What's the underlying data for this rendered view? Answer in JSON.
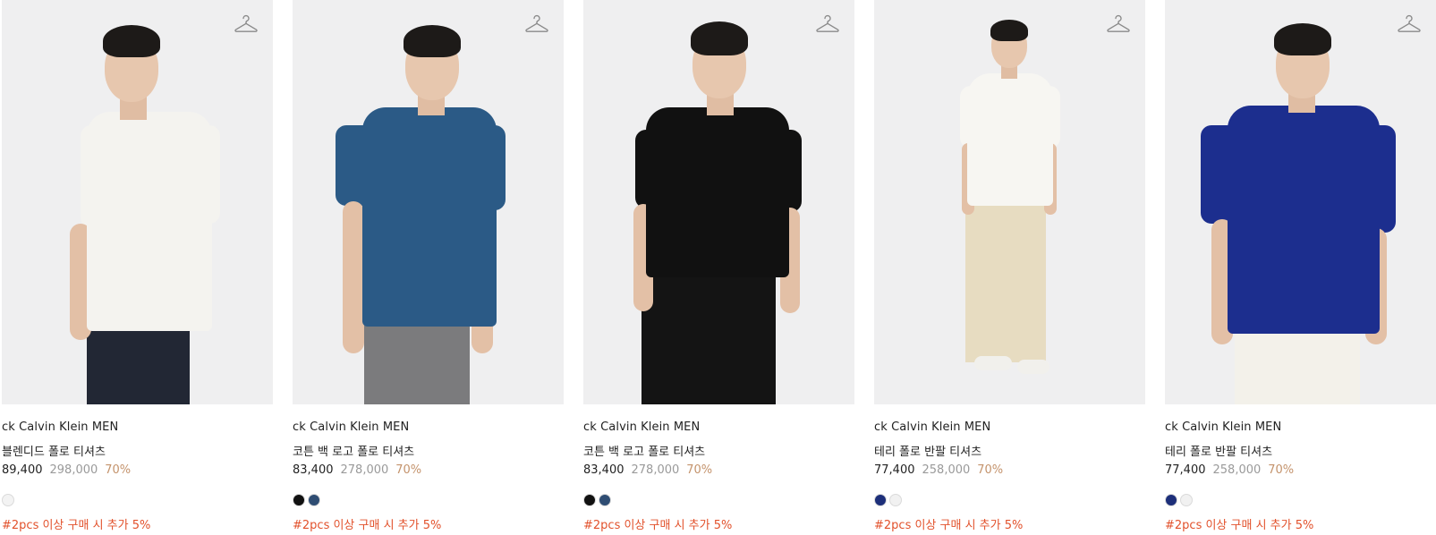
{
  "products": [
    {
      "brand": "ck Calvin Klein MEN",
      "name": "블렌디드 폴로 티셔츠",
      "price": "89,400",
      "original_price": "298,000",
      "discount": "70%",
      "swatches": [
        "#f3f3f3"
      ],
      "promo": "#2pcs 이상 구매 시 추가 5%",
      "shirt_color": "#f4f3ef",
      "pants_color": "#222734"
    },
    {
      "brand": "ck Calvin Klein MEN",
      "name": "코튼 백 로고 폴로 티셔츠",
      "price": "83,400",
      "original_price": "278,000",
      "discount": "70%",
      "swatches": [
        "#111111",
        "#2f4d73"
      ],
      "promo": "#2pcs 이상 구매 시 추가 5%",
      "shirt_color": "#2b5a86",
      "pants_color": "#7b7b7d"
    },
    {
      "brand": "ck Calvin Klein MEN",
      "name": "코튼 백 로고 폴로 티셔츠",
      "price": "83,400",
      "original_price": "278,000",
      "discount": "70%",
      "swatches": [
        "#111111",
        "#2f4d73"
      ],
      "promo": "#2pcs 이상 구매 시 추가 5%",
      "shirt_color": "#111111",
      "pants_color": "#141414"
    },
    {
      "brand": "ck Calvin Klein MEN",
      "name": "테리 폴로 반팔 티셔츠",
      "price": "77,400",
      "original_price": "258,000",
      "discount": "70%",
      "swatches": [
        "#1d2f7a",
        "#f1f1f1"
      ],
      "promo": "#2pcs 이상 구매 시 추가 5%",
      "shirt_color": "#f7f6f2",
      "pants_color": "#e7dcc1"
    },
    {
      "brand": "ck Calvin Klein MEN",
      "name": "테리 폴로 반팔 티셔츠",
      "price": "77,400",
      "original_price": "258,000",
      "discount": "70%",
      "swatches": [
        "#1d2f7a",
        "#f1f1f1"
      ],
      "promo": "#2pcs 이상 구매 시 추가 5%",
      "shirt_color": "#1c2e8e",
      "pants_color": "#f3f1ea"
    }
  ],
  "icons": {
    "wishlist": "hanger-icon"
  }
}
